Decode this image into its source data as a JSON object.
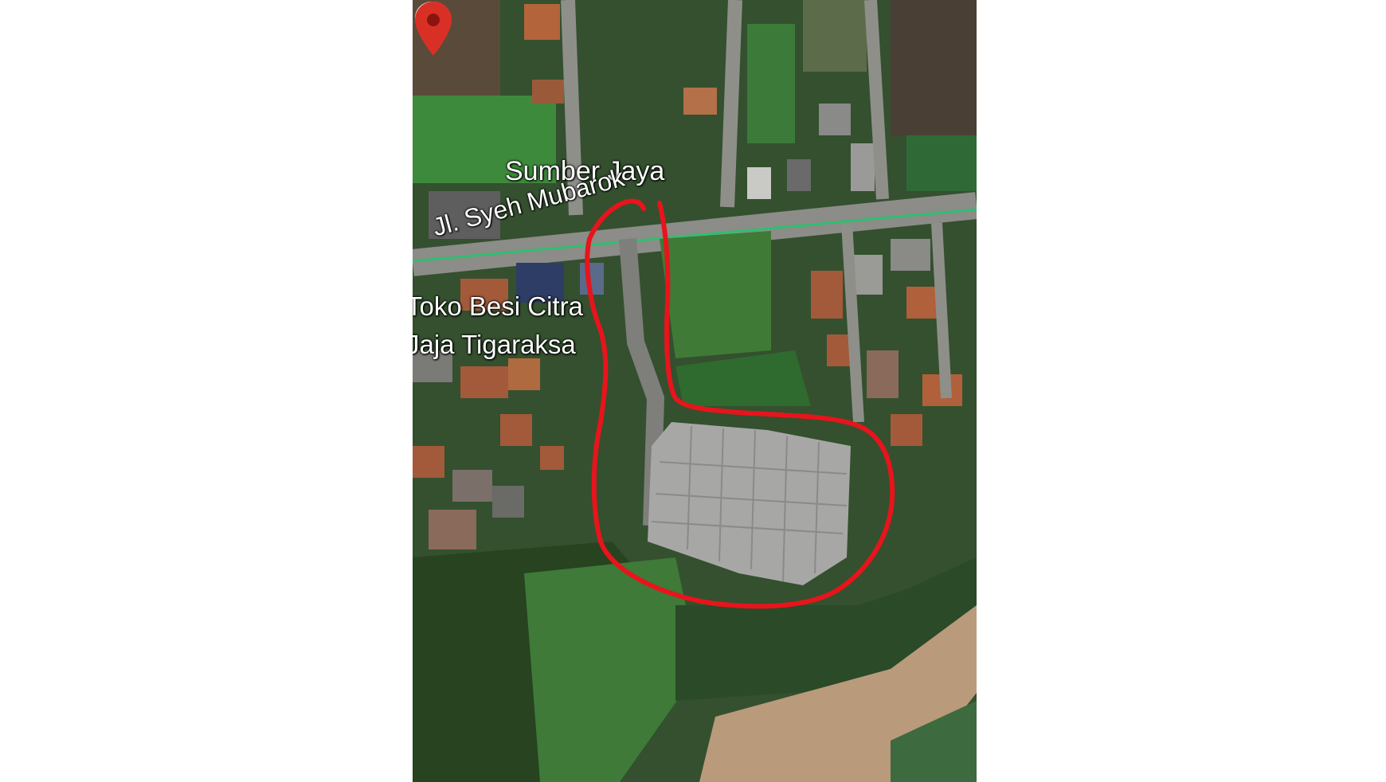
{
  "map": {
    "poi_sumber_jaya": "Sumber Jaya",
    "road_name": "Jl. Syeh Mubarok",
    "poi_toko_line1": "Toko Besi Citra",
    "poi_toko_line2": "Jaja Tigaraksa",
    "icons": {
      "store_pin": "shopping-bag-pin-icon",
      "location_pin": "red-location-pin-icon"
    },
    "colors": {
      "annotation": "#e8141c",
      "road_highlight": "#2fbf71",
      "store_pin": "#1a73e8",
      "location_pin": "#d93025"
    }
  }
}
